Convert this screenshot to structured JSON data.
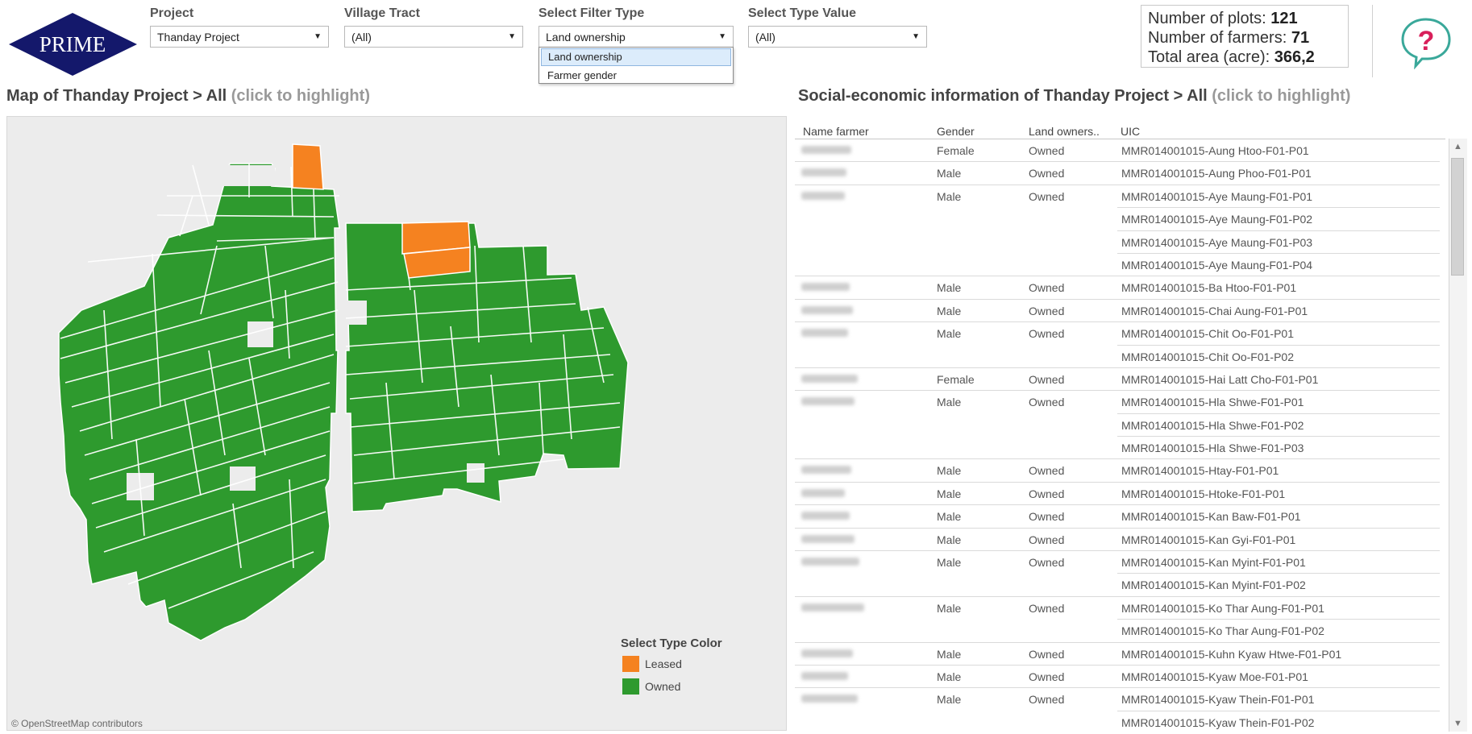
{
  "logo_text": "PRIME",
  "filters": {
    "project": {
      "label": "Project",
      "value": "Thanday Project"
    },
    "village_tract": {
      "label": "Village Tract",
      "value": "(All)"
    },
    "filter_type": {
      "label": "Select Filter Type",
      "value": "Land ownership",
      "options": [
        "Land ownership",
        "Farmer gender"
      ]
    },
    "type_value": {
      "label": "Select Type Value",
      "value": "(All)"
    }
  },
  "stats": {
    "plots_label": "Number of plots:",
    "plots_value": "121",
    "farmers_label": "Number of farmers:",
    "farmers_value": "71",
    "area_label": "Total area (acre):",
    "area_value": "366,2"
  },
  "help_icon": "question-bubble-icon",
  "map": {
    "title": "Map of Thanday Project > All",
    "hint": "(click to highlight)",
    "credit": "© OpenStreetMap contributors",
    "legend_title": "Select Type Color",
    "legend": [
      {
        "label": "Leased",
        "color": "#f58220"
      },
      {
        "label": "Owned",
        "color": "#2e9a2e"
      }
    ]
  },
  "table": {
    "title": "Social-economic information of Thanday Project > All",
    "hint": "(click to highlight)",
    "columns": [
      "Name farmer",
      "Gender",
      "Land owners..",
      "UIC"
    ],
    "rows": [
      {
        "gender": "Female",
        "land": "Owned",
        "uic": "MMR014001015-Aung Htoo-F01-P01",
        "first": true
      },
      {
        "gender": "Male",
        "land": "Owned",
        "uic": "MMR014001015-Aung Phoo-F01-P01",
        "first": true
      },
      {
        "gender": "Male",
        "land": "Owned",
        "uic": "MMR014001015-Aye Maung-F01-P01",
        "first": true
      },
      {
        "gender": "",
        "land": "",
        "uic": "MMR014001015-Aye Maung-F01-P02",
        "first": false
      },
      {
        "gender": "",
        "land": "",
        "uic": "MMR014001015-Aye Maung-F01-P03",
        "first": false
      },
      {
        "gender": "",
        "land": "",
        "uic": "MMR014001015-Aye Maung-F01-P04",
        "first": false
      },
      {
        "gender": "Male",
        "land": "Owned",
        "uic": "MMR014001015-Ba Htoo-F01-P01",
        "first": true
      },
      {
        "gender": "Male",
        "land": "Owned",
        "uic": "MMR014001015-Chai Aung-F01-P01",
        "first": true
      },
      {
        "gender": "Male",
        "land": "Owned",
        "uic": "MMR014001015-Chit Oo-F01-P01",
        "first": true
      },
      {
        "gender": "",
        "land": "",
        "uic": "MMR014001015-Chit Oo-F01-P02",
        "first": false
      },
      {
        "gender": "Female",
        "land": "Owned",
        "uic": "MMR014001015-Hai Latt Cho-F01-P01",
        "first": true
      },
      {
        "gender": "Male",
        "land": "Owned",
        "uic": "MMR014001015-Hla Shwe-F01-P01",
        "first": true
      },
      {
        "gender": "",
        "land": "",
        "uic": "MMR014001015-Hla Shwe-F01-P02",
        "first": false
      },
      {
        "gender": "",
        "land": "",
        "uic": "MMR014001015-Hla Shwe-F01-P03",
        "first": false
      },
      {
        "gender": "Male",
        "land": "Owned",
        "uic": "MMR014001015-Htay-F01-P01",
        "first": true
      },
      {
        "gender": "Male",
        "land": "Owned",
        "uic": "MMR014001015-Htoke-F01-P01",
        "first": true
      },
      {
        "gender": "Male",
        "land": "Owned",
        "uic": "MMR014001015-Kan Baw-F01-P01",
        "first": true
      },
      {
        "gender": "Male",
        "land": "Owned",
        "uic": "MMR014001015-Kan Gyi-F01-P01",
        "first": true
      },
      {
        "gender": "Male",
        "land": "Owned",
        "uic": "MMR014001015-Kan Myint-F01-P01",
        "first": true
      },
      {
        "gender": "",
        "land": "",
        "uic": "MMR014001015-Kan Myint-F01-P02",
        "first": false
      },
      {
        "gender": "Male",
        "land": "Owned",
        "uic": "MMR014001015-Ko Thar Aung-F01-P01",
        "first": true
      },
      {
        "gender": "",
        "land": "",
        "uic": "MMR014001015-Ko Thar Aung-F01-P02",
        "first": false
      },
      {
        "gender": "Male",
        "land": "Owned",
        "uic": "MMR014001015-Kuhn Kyaw Htwe-F01-P01",
        "first": true
      },
      {
        "gender": "Male",
        "land": "Owned",
        "uic": "MMR014001015-Kyaw Moe-F01-P01",
        "first": true
      },
      {
        "gender": "Male",
        "land": "Owned",
        "uic": "MMR014001015-Kyaw Thein-F01-P01",
        "first": true
      },
      {
        "gender": "",
        "land": "",
        "uic": "MMR014001015-Kyaw Thein-F01-P02",
        "first": false
      }
    ]
  }
}
